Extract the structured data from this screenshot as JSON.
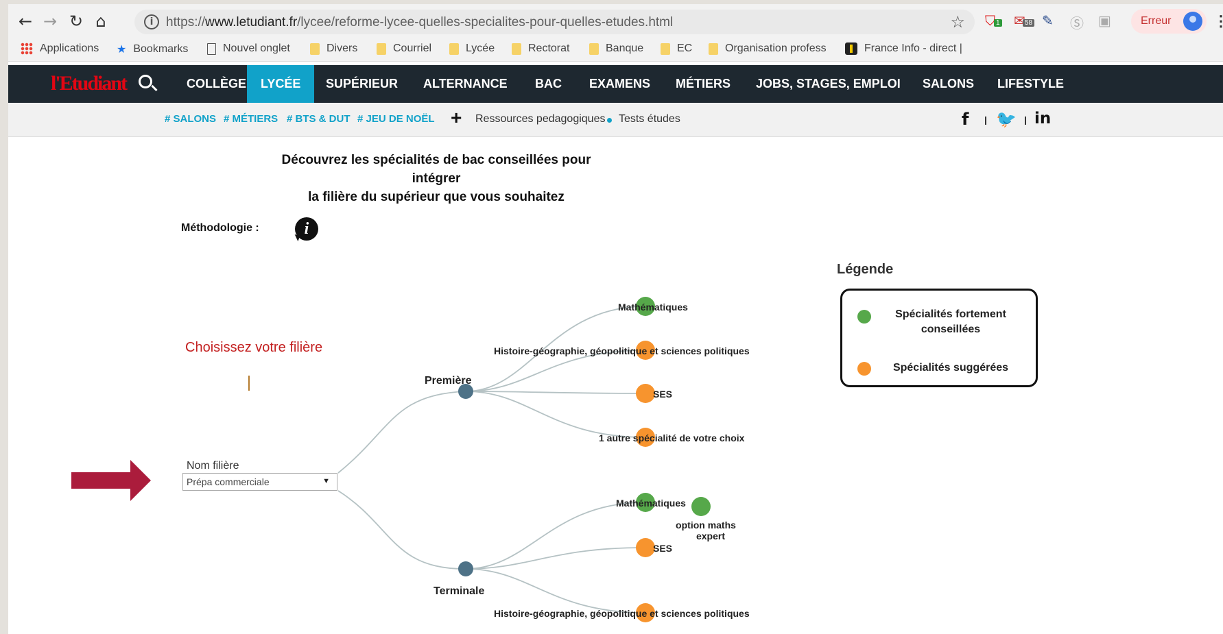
{
  "browser": {
    "url_prefix": "https://",
    "url_host": "www.letudiant.fr",
    "url_path": "/lycee/reforme-lycee-quelles-specialites-pour-quelles-etudes.html",
    "ext_badge_1": "1",
    "ext_badge_2": "58",
    "profile_label": "Erreur"
  },
  "bookmarks": [
    "Applications",
    "Bookmarks",
    "Nouvel onglet",
    "Divers",
    "Courriel",
    "Lycée",
    "Rectorat",
    "Banque",
    "EC",
    "Organisation profess",
    "France Info - direct |"
  ],
  "site": {
    "logo": "l'Etudiant",
    "nav": [
      "COLLÈGE",
      "LYCÉE",
      "SUPÉRIEUR",
      "ALTERNANCE",
      "BAC",
      "EXAMENS",
      "MÉTIERS",
      "JOBS, STAGES, EMPLOI",
      "SALONS",
      "LIFESTYLE"
    ],
    "tags": [
      "# SALONS",
      "# MÉTIERS",
      "# BTS & DUT",
      "# JEU DE NOËL"
    ],
    "plus": "+",
    "links": [
      "Ressources pedagogiques",
      "Tests études"
    ],
    "accent": "#11a2c9"
  },
  "content": {
    "headline_1": "Découvrez les spécialités de bac conseillées pour intégrer",
    "headline_2": "la filière du supérieur que vous souhaitez",
    "methodologie": "Méthodologie :",
    "info_glyph": "i",
    "choose": "Choisissez votre filière",
    "field_label": "Nom filière",
    "field_value": "Prépa commerciale"
  },
  "tree": {
    "premiere": "Première",
    "terminale": "Terminale",
    "premiere_items": [
      {
        "label": "Mathématiques",
        "type": "strong"
      },
      {
        "label": "Histoire-géographie, géopolitique et sciences politiques",
        "type": "suggested"
      },
      {
        "label": "SES",
        "type": "suggested"
      },
      {
        "label": "1 autre spécialité de votre choix",
        "type": "suggested"
      }
    ],
    "terminale_items": [
      {
        "label": "Mathématiques",
        "type": "strong"
      },
      {
        "label": "SES",
        "type": "suggested"
      },
      {
        "label": "Histoire-géographie, géopolitique et sciences politiques",
        "type": "suggested"
      }
    ],
    "option_line_1": "option maths",
    "option_line_2": "expert"
  },
  "legend": {
    "title": "Légende",
    "strong_1": "Spécialités fortement",
    "strong_2": "conseillées",
    "suggested": "Spécialités suggérées"
  },
  "colors": {
    "strong": "#56a84a",
    "suggested": "#f7942e",
    "node": "#4e7287",
    "link": "#b5c2c4",
    "arrow": "#ab1c3c"
  }
}
